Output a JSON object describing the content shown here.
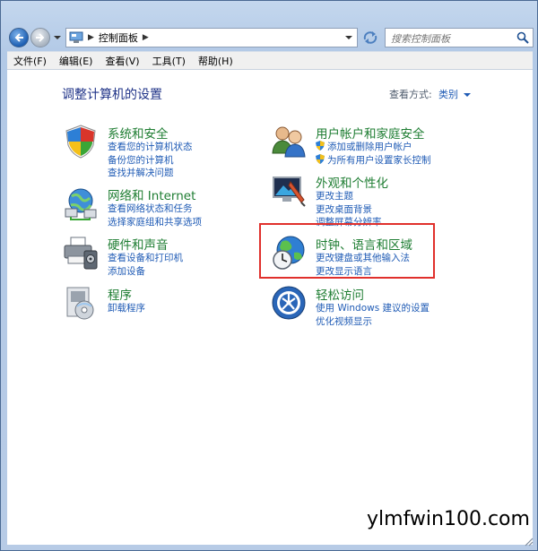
{
  "address": {
    "path": "控制面板",
    "back_icon": "arrow-left-icon",
    "forward_icon": "arrow-right-icon"
  },
  "search": {
    "placeholder": "搜索控制面板"
  },
  "menu": [
    {
      "label": "文件(F)"
    },
    {
      "label": "编辑(E)"
    },
    {
      "label": "查看(V)"
    },
    {
      "label": "工具(T)"
    },
    {
      "label": "帮助(H)"
    }
  ],
  "page": {
    "title": "调整计算机的设置",
    "view_by_label": "查看方式:",
    "view_by_value": "类别"
  },
  "categories": [
    {
      "title": "系统和安全",
      "icon": "shield-icon",
      "links": [
        "查看您的计算机状态",
        "备份您的计算机",
        "查找并解决问题"
      ]
    },
    {
      "title": "网络和 Internet",
      "icon": "network-icon",
      "links": [
        "查看网络状态和任务",
        "选择家庭组和共享选项"
      ]
    },
    {
      "title": "硬件和声音",
      "icon": "printer-icon",
      "links": [
        "查看设备和打印机",
        "添加设备"
      ]
    },
    {
      "title": "程序",
      "icon": "programs-icon",
      "links": [
        "卸载程序"
      ]
    },
    {
      "title": "用户帐户和家庭安全",
      "icon": "users-icon",
      "links": [
        "添加或删除用户帐户",
        "为所有用户设置家长控制"
      ]
    },
    {
      "title": "外观和个性化",
      "icon": "monitor-icon",
      "links": [
        "更改主题",
        "更改桌面背景",
        "调整屏幕分辨率"
      ]
    },
    {
      "title": "时钟、语言和区域",
      "icon": "globe-clock-icon",
      "links": [
        "更改键盘或其他输入法",
        "更改显示语言"
      ]
    },
    {
      "title": "轻松访问",
      "icon": "accessibility-icon",
      "links": [
        "使用 Windows 建议的设置",
        "优化视频显示"
      ]
    }
  ],
  "watermark": "ylmfwin100.com",
  "colors": {
    "category_title": "#1e7d32",
    "link": "#1f5bb5",
    "highlight": "#e0302c"
  }
}
